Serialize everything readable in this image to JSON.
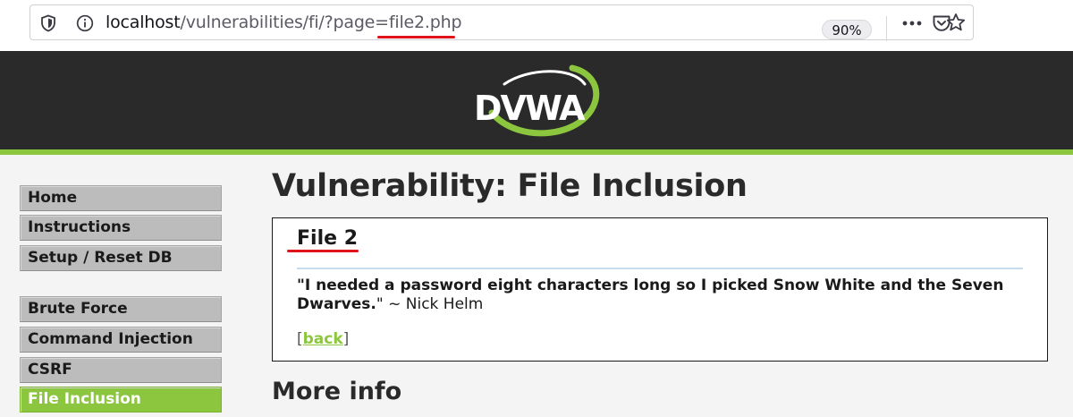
{
  "browser": {
    "url_host": "localhost",
    "url_path": "/vulnerabilities/fi/?page=",
    "url_param": "file2.php",
    "zoom": "90%",
    "icons": [
      "shield-icon",
      "info-icon",
      "more-icon",
      "pocket-icon",
      "bookmark-star-icon"
    ]
  },
  "header": {
    "logo_text": "DVWA"
  },
  "menu": {
    "items": [
      {
        "label": "Home"
      },
      {
        "label": "Instructions"
      },
      {
        "label": "Setup / Reset DB"
      },
      {
        "label": "Brute Force"
      },
      {
        "label": "Command Injection"
      },
      {
        "label": "CSRF"
      },
      {
        "label": "File Inclusion",
        "active": true
      }
    ]
  },
  "main": {
    "title": "Vulnerability: File Inclusion",
    "box_title": "File 2",
    "quote_bold": "\"I needed a password eight characters long so I picked Snow White and the Seven Dwarves.",
    "quote_close": "\"",
    "quote_author": " ~ Nick Helm",
    "back_open": "[",
    "back_link": "back",
    "back_close": "]",
    "more_info": "More info"
  },
  "colors": {
    "accent_green": "#8cc63f",
    "header_bg": "#2a2a2a",
    "annotation_red": "#e0121b"
  }
}
